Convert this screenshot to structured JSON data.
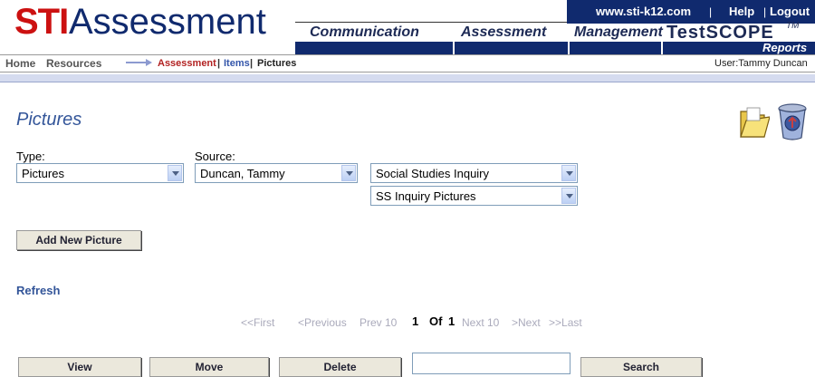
{
  "header": {
    "logo_sti": "STI",
    "logo_assessment": "Assessment",
    "top_links": [
      "www.sti-k12.com",
      "Help",
      "Logout"
    ],
    "separator": "|",
    "nav_tabs": [
      "Communication",
      "Assessment",
      "Management"
    ],
    "testscope": "TestSCOPE",
    "testscope_tm": "TM",
    "testscope_reports": "Reports"
  },
  "breadcrumb": {
    "home": "Home",
    "resources": "Resources",
    "assessment": "Assessment",
    "sep": "|",
    "items": "Items",
    "pictures": "Pictures",
    "user": "User:Tammy Duncan"
  },
  "page": {
    "title": "Pictures",
    "type_label": "Type:",
    "type_value": "Pictures",
    "source_label": "Source:",
    "source_value": "Duncan, Tammy",
    "course_value": "Social Studies Inquiry",
    "folder_value": "SS Inquiry Pictures",
    "add_button": "Add New Picture",
    "refresh": "Refresh"
  },
  "pagination": {
    "first": "<<First",
    "previous": "<Previous",
    "prev10": "Prev 10",
    "current": "1",
    "of": "Of",
    "total": "1",
    "next10": "Next 10",
    "next": ">Next",
    "last": ">>Last"
  },
  "actions": {
    "view": "View",
    "move": "Move",
    "delete": "Delete",
    "search_value": "",
    "search": "Search"
  },
  "colors": {
    "brand_red": "#cc1111",
    "brand_navy": "#102a6e",
    "link_blue": "#335599"
  },
  "icons": [
    "folder-open-icon",
    "recycle-bin-icon",
    "arrow-right-icon"
  ]
}
